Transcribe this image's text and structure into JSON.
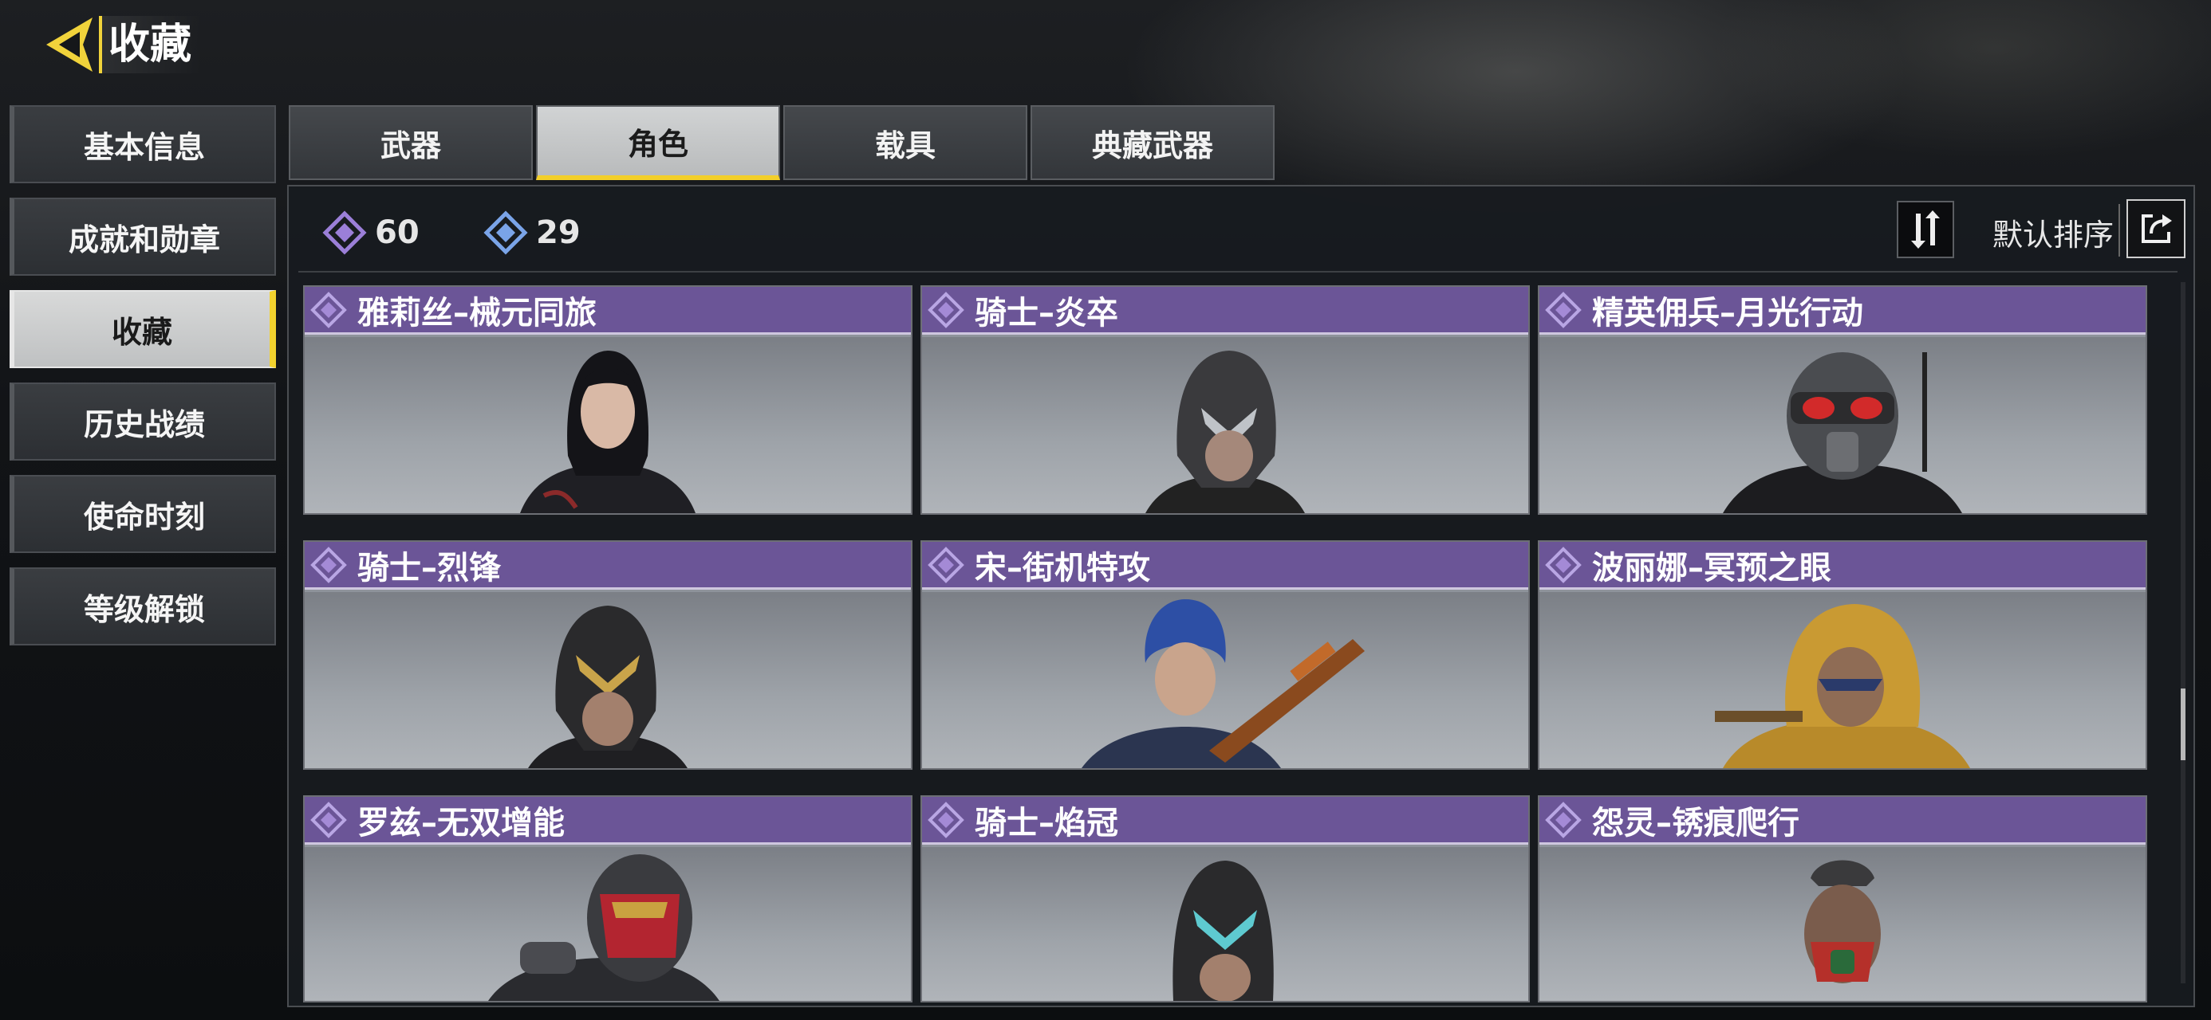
{
  "header": {
    "title": "收藏"
  },
  "sidebar": {
    "items": [
      {
        "label": "基本信息",
        "active": false
      },
      {
        "label": "成就和勋章",
        "active": false
      },
      {
        "label": "收藏",
        "active": true
      },
      {
        "label": "历史战绩",
        "active": false
      },
      {
        "label": "使命时刻",
        "active": false
      },
      {
        "label": "等级解锁",
        "active": false
      }
    ]
  },
  "tabs": [
    {
      "label": "武器",
      "active": false
    },
    {
      "label": "角色",
      "active": true
    },
    {
      "label": "载具",
      "active": false
    },
    {
      "label": "典藏武器",
      "active": false
    }
  ],
  "toolbar": {
    "currency_purple": "60",
    "currency_blue": "29",
    "sort_label": "默认排序"
  },
  "colors": {
    "accent": "#f3d22e",
    "card_header": "#6b5597",
    "gem_purple": "#9b7fd8",
    "gem_blue": "#7aa4e8"
  },
  "cards": [
    {
      "name": "雅莉丝–械元同旅",
      "rarity_icon": "diamond-gem-icon"
    },
    {
      "name": "骑士–炎卒",
      "rarity_icon": "diamond-gem-icon"
    },
    {
      "name": "精英佣兵–月光行动",
      "rarity_icon": "diamond-gem-icon"
    },
    {
      "name": "骑士–烈锋",
      "rarity_icon": "diamond-gem-icon"
    },
    {
      "name": "宋–街机特攻",
      "rarity_icon": "diamond-gem-icon"
    },
    {
      "name": "波丽娜–冥预之眼",
      "rarity_icon": "diamond-gem-icon"
    },
    {
      "name": "罗兹–无双增能",
      "rarity_icon": "diamond-gem-icon"
    },
    {
      "name": "骑士–焰冠",
      "rarity_icon": "diamond-gem-icon"
    },
    {
      "name": "怨灵–锈痕爬行",
      "rarity_icon": "diamond-gem-icon"
    }
  ]
}
